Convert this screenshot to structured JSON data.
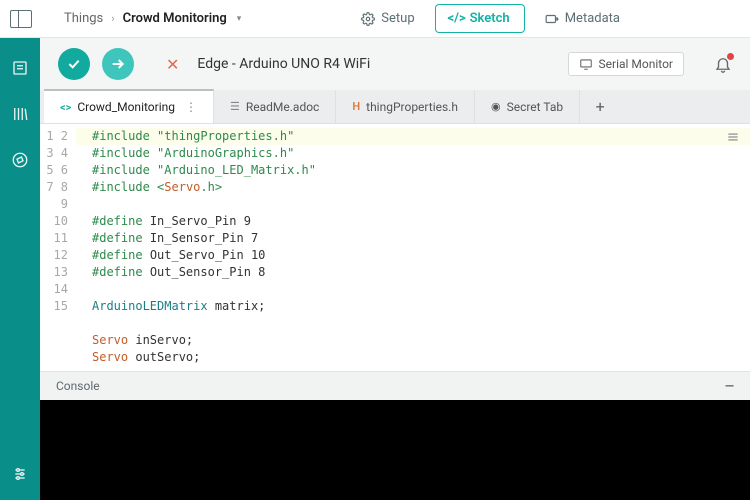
{
  "breadcrumb": {
    "root": "Things",
    "current": "Crowd Monitoring"
  },
  "nav": {
    "setup": "Setup",
    "sketch": "Sketch",
    "metadata": "Metadata"
  },
  "header": {
    "board": "Edge - Arduino UNO R4 WiFi",
    "serial": "Serial Monitor"
  },
  "tabs": [
    {
      "label": "Crowd_Monitoring",
      "icon": "code",
      "active": true,
      "more": true
    },
    {
      "label": "ReadMe.adoc",
      "icon": "doc"
    },
    {
      "label": "thingProperties.h",
      "icon": "h"
    },
    {
      "label": "Secret Tab",
      "icon": "eye"
    }
  ],
  "code": {
    "lines": [
      {
        "n": 1,
        "html": "<span class='kw'>#include</span> <span class='str'>\"thingProperties.h\"</span>"
      },
      {
        "n": 2,
        "html": "<span class='kw'>#include</span> <span class='str'>\"ArduinoGraphics.h\"</span>"
      },
      {
        "n": 3,
        "html": "<span class='kw'>#include</span> <span class='str'>\"Arduino_LED_Matrix.h\"</span>"
      },
      {
        "n": 4,
        "html": "<span class='kw'>#include</span> <span class='str'>&lt;</span><span class='lib'>Servo</span><span class='str'>.h&gt;</span>"
      },
      {
        "n": 5,
        "html": ""
      },
      {
        "n": 6,
        "html": "<span class='def'>#define</span> <span class='id'>In_Servo_Pin 9</span>"
      },
      {
        "n": 7,
        "html": "<span class='def'>#define</span> <span class='id'>In_Sensor_Pin 7</span>"
      },
      {
        "n": 8,
        "html": "<span class='def'>#define</span> <span class='id'>Out_Servo_Pin 10</span>"
      },
      {
        "n": 9,
        "html": "<span class='def'>#define</span> <span class='id'>Out_Sensor_Pin 8</span>"
      },
      {
        "n": 10,
        "html": ""
      },
      {
        "n": 11,
        "html": "<span class='type'>ArduinoLEDMatrix</span> <span class='id'>matrix;</span>"
      },
      {
        "n": 12,
        "html": ""
      },
      {
        "n": 13,
        "html": "<span class='lib'>Servo</span> <span class='id'>inServo;</span>"
      },
      {
        "n": 14,
        "html": "<span class='lib'>Servo</span> <span class='id'>outServo;</span>"
      },
      {
        "n": 15,
        "html": ""
      }
    ],
    "highlight_line": 1
  },
  "console": {
    "label": "Console"
  }
}
